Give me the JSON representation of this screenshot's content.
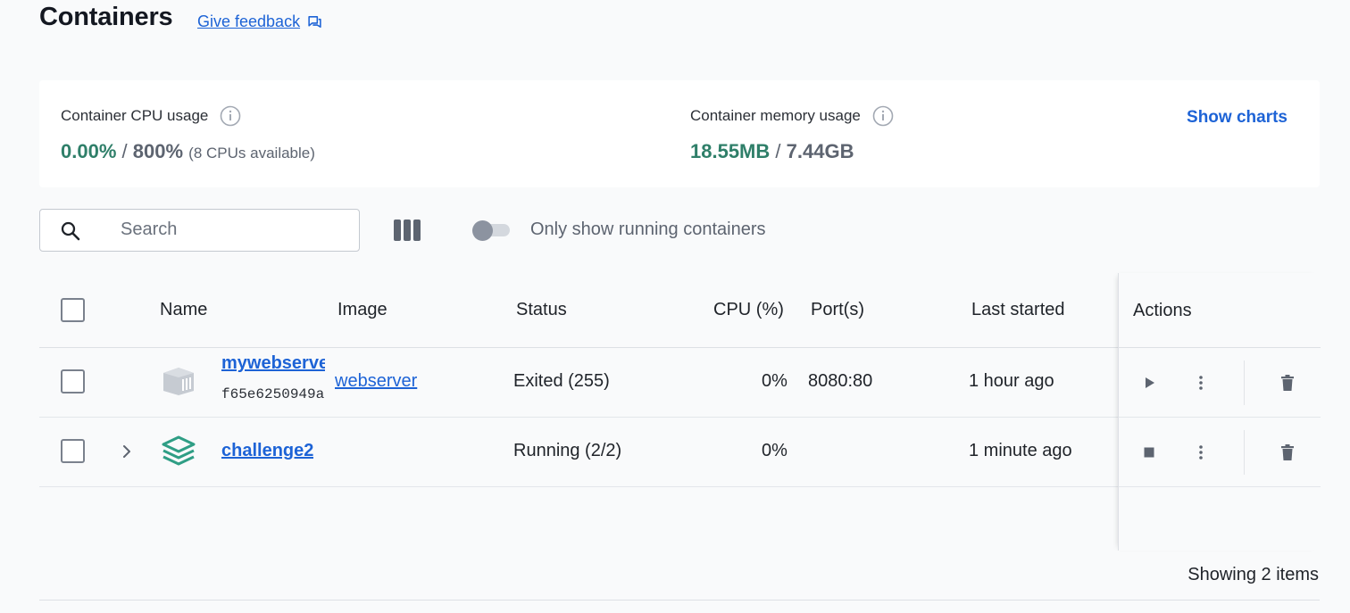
{
  "page": {
    "title": "Containers",
    "feedback_label": "Give feedback",
    "feedback_icon": "chat-bubble-icon"
  },
  "stats": {
    "cpu": {
      "label": "Container CPU usage",
      "used": "0.00%",
      "separator": "/",
      "total": "800%",
      "note": "(8 CPUs available)"
    },
    "memory": {
      "label": "Container memory usage",
      "used": "18.55MB",
      "separator": "/",
      "total": "7.44GB"
    },
    "show_charts_label": "Show charts",
    "accent_color": "#2f7f69"
  },
  "toolbar": {
    "search_placeholder": "Search",
    "search_value": "",
    "columns_icon": "columns-icon",
    "running_toggle_label": "Only show running containers",
    "running_toggle_on": false
  },
  "table": {
    "headers": {
      "name": "Name",
      "image": "Image",
      "status": "Status",
      "cpu": "CPU (%)",
      "ports": "Port(s)",
      "last_started": "Last started",
      "actions": "Actions"
    },
    "rows": [
      {
        "name": "mywebserver",
        "id": "f65e6250949a",
        "image": "webserver",
        "status": "Exited (255)",
        "cpu": "0%",
        "ports": "8080:80",
        "last_started": "1 hour ago",
        "icon": "container-icon",
        "action": "start"
      },
      {
        "name": "challenge2",
        "id": "",
        "image": "",
        "status": "Running (2/2)",
        "cpu": "0%",
        "ports": "",
        "last_started": "1 minute ago",
        "icon": "compose-stack-icon",
        "action": "stop"
      }
    ],
    "footer": "Showing 2 items"
  },
  "colors": {
    "link": "#1d63d6",
    "green": "#2f7f69",
    "muted": "#5d6470"
  }
}
